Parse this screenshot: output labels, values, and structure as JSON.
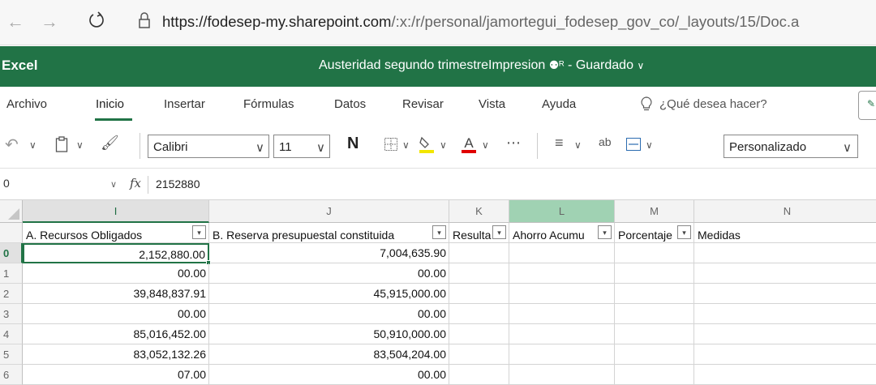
{
  "browser": {
    "url_host": "https://fodesep-my.sharepoint.com",
    "url_path": "/:x:/r/personal/jamortegui_fodesep_gov_co/_layouts/15/Doc.a"
  },
  "app": {
    "name": "Excel",
    "doc_title": "Austeridad segundo trimestreImpresion",
    "status": "Guardado"
  },
  "menu": {
    "tabs": [
      "Archivo",
      "Inicio",
      "Insertar",
      "Fórmulas",
      "Datos",
      "Revisar",
      "Vista",
      "Ayuda"
    ],
    "active_tab": "Inicio",
    "search_placeholder": "¿Qué desea hacer?"
  },
  "toolbar": {
    "font_name": "Calibri",
    "font_size": "11",
    "bold_label": "N",
    "number_format": "Personalizado"
  },
  "formula_bar": {
    "name_box": "0",
    "fx_label": "fx",
    "value": "2152880"
  },
  "columns": [
    {
      "letter": "I",
      "header": "A. Recursos Obligados",
      "selected": true
    },
    {
      "letter": "J",
      "header": "B. Reserva presupuestal constituida",
      "selected": false
    },
    {
      "letter": "K",
      "header": "Resulta",
      "selected": false
    },
    {
      "letter": "L",
      "header": "Ahorro Acumu",
      "selected": false,
      "highlighted": true
    },
    {
      "letter": "M",
      "header": "Porcentaje",
      "selected": false
    },
    {
      "letter": "N",
      "header": "Medidas",
      "selected": false
    }
  ],
  "rows": [
    {
      "label": "",
      "I": "",
      "J": ""
    },
    {
      "label": "0",
      "I": "2,152,880.00",
      "J": "7,004,635.90",
      "active": true
    },
    {
      "label": "1",
      "I": "00.00",
      "J": "00.00"
    },
    {
      "label": "2",
      "I": "39,848,837.91",
      "J": "45,915,000.00"
    },
    {
      "label": "3",
      "I": "00.00",
      "J": "00.00"
    },
    {
      "label": "4",
      "I": "85,016,452.00",
      "J": "50,910,000.00"
    },
    {
      "label": "5",
      "I": "83,052,132.26",
      "J": "83,504,204.00"
    },
    {
      "label": "6",
      "I": "07.00",
      "J": "00.00"
    }
  ],
  "colors": {
    "excel_green": "#217346",
    "highlight_yellow": "#f2e600",
    "font_red": "#e00000"
  }
}
